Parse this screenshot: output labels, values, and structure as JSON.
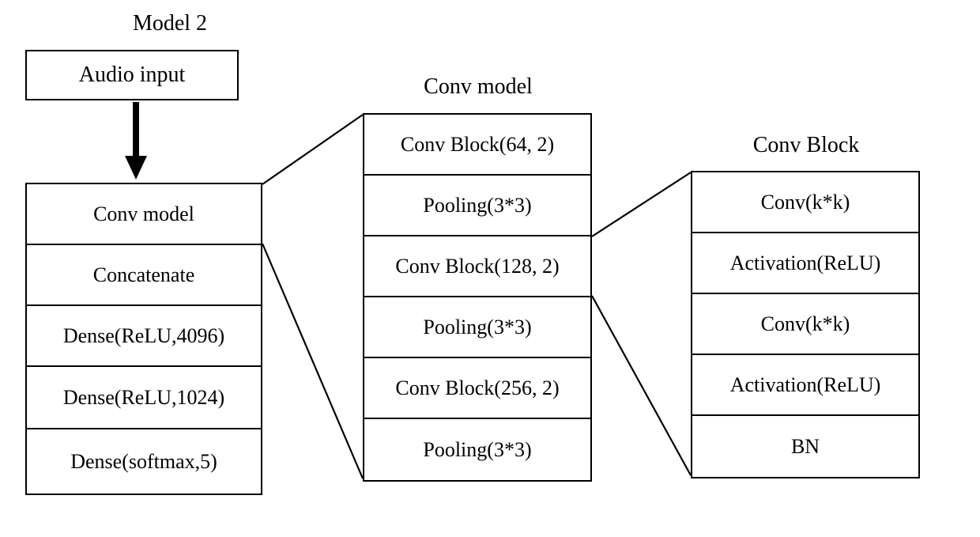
{
  "titles": {
    "model2": "Model 2",
    "conv_model": "Conv  model",
    "conv_block": "Conv  Block"
  },
  "input_box": "Audio input",
  "model2_layers": [
    "Conv model",
    "Concatenate",
    "Dense(ReLU,4096)",
    "Dense(ReLU,1024)",
    "Dense(softmax,5)"
  ],
  "conv_model_layers": [
    "Conv Block(64, 2)",
    "Pooling(3*3)",
    "Conv Block(128, 2)",
    "Pooling(3*3)",
    "Conv Block(256, 2)",
    "Pooling(3*3)"
  ],
  "conv_block_layers": [
    "Conv(k*k)",
    "Activation(ReLU)",
    "Conv(k*k)",
    "Activation(ReLU)",
    "BN"
  ]
}
